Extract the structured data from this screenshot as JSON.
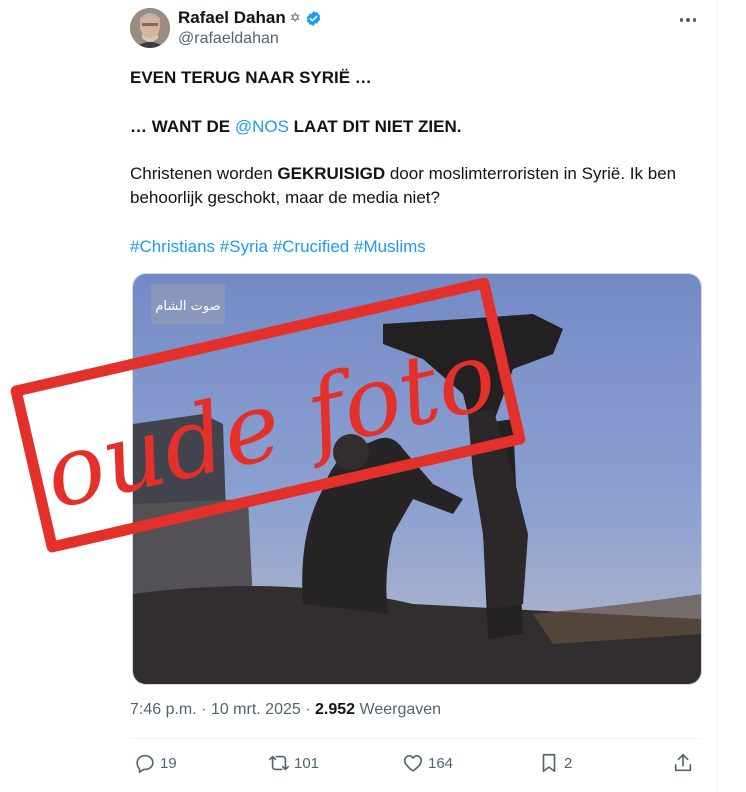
{
  "author": {
    "name": "Rafael Dahan",
    "symbol": "✡",
    "handle": "@rafaeldahan"
  },
  "tweet": {
    "line1": "EVEN TERUG NAAR SYRIË …",
    "line2_pre": "… WANT DE ",
    "line2_mention": "@NOS",
    "line2_post": " LAAT DIT NIET ZIEN.",
    "body_pre": "Christenen worden ",
    "body_bold": "GEKRUISIGD",
    "body_post": " door moslimterroristen in Syrië. Ik ben behoorlijk geschokt, maar de media niet?",
    "hashtags": [
      "#Christians",
      "#Syria",
      "#Crucified",
      "#Muslims"
    ]
  },
  "media": {
    "watermark": "صوت الشام",
    "stamp_text": "oude foto"
  },
  "meta": {
    "time": "7:46 p.m.",
    "separator": "·",
    "date": "10 mrt. 2025",
    "views_count": "2.952",
    "views_label": "Weergaven"
  },
  "actions": {
    "replies": "19",
    "reposts": "101",
    "likes": "164",
    "bookmarks": "2"
  },
  "colors": {
    "link": "#1d9bf0",
    "secondary": "#536471",
    "stamp": "#e3302b"
  }
}
